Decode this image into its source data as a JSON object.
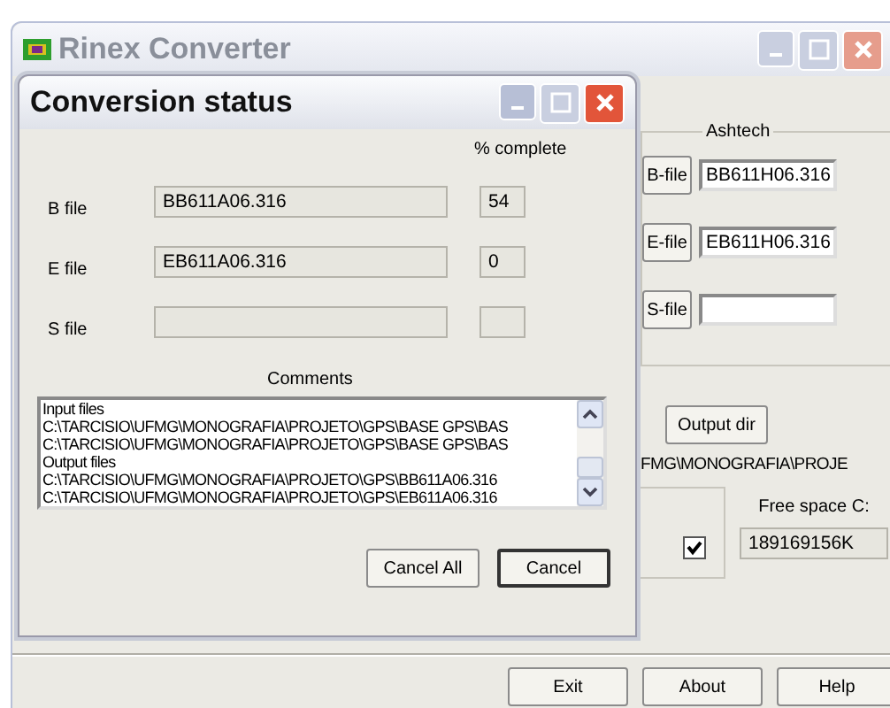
{
  "main_window": {
    "title": "Rinex Converter"
  },
  "ashtech": {
    "title": "Ashtech",
    "files": [
      {
        "button": "B-file",
        "value": "BB611H06.316"
      },
      {
        "button": "E-file",
        "value": "EB611H06.316"
      },
      {
        "button": "S-file"
      }
    ]
  },
  "output_dir": {
    "button": "Output dir",
    "path": "FMG\\MONOGRAFIA\\PROJE"
  },
  "option_checkbox": {
    "checked": true
  },
  "free_space": {
    "label": "Free space C:",
    "value": "189169156K"
  },
  "footer_buttons": [
    "Exit",
    "About",
    "Help"
  ],
  "dialog": {
    "title": "Conversion status",
    "percent_header": "% complete",
    "rows": [
      {
        "label": "B file",
        "file": "BB611A06.316",
        "percent": "54"
      },
      {
        "label": "E file",
        "file": "EB611A06.316",
        "percent": "0"
      },
      {
        "label": "S file"
      }
    ],
    "comments_label": "Comments",
    "comments": [
      "Input files",
      "C:\\TARCISIO\\UFMG\\MONOGRAFIA\\PROJETO\\GPS\\BASE GPS\\BAS",
      "C:\\TARCISIO\\UFMG\\MONOGRAFIA\\PROJETO\\GPS\\BASE GPS\\BAS",
      "Output files",
      "C:\\TARCISIO\\UFMG\\MONOGRAFIA\\PROJETO\\GPS\\BB611A06.316",
      "C:\\TARCISIO\\UFMG\\MONOGRAFIA\\PROJETO\\GPS\\EB611A06.316"
    ],
    "buttons": [
      {
        "label": "Cancel All",
        "default": false
      },
      {
        "label": "Cancel",
        "default": true
      }
    ]
  }
}
